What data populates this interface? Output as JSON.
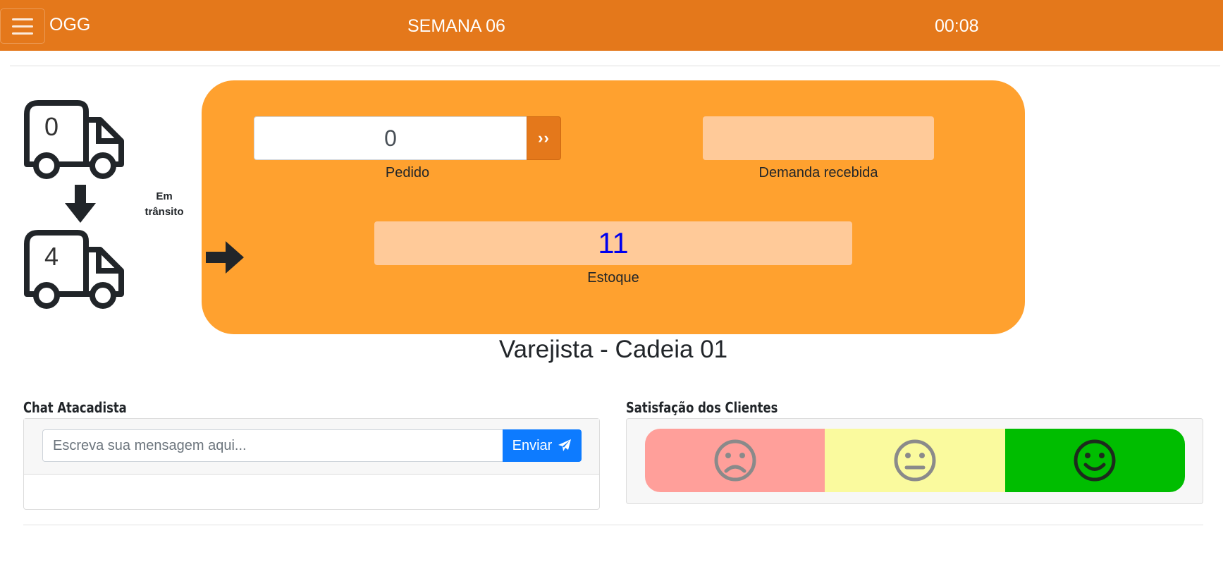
{
  "navbar": {
    "brand": "OGG",
    "week": "SEMANA 06",
    "timer": "00:08",
    "icon": "hamburger-menu-icon",
    "color": "#e4781b"
  },
  "pipeline": {
    "truck_top_count": "0",
    "truck_bottom_count": "4",
    "transit_label_line1": "Em",
    "transit_label_line2": "trânsito",
    "icons": [
      "truck-icon",
      "arrow-down-icon",
      "arrow-right-icon"
    ]
  },
  "station": {
    "order_value": "0",
    "order_button_label": "››",
    "order_label": "Pedido",
    "demand_value": "",
    "demand_label": "Demanda recebida",
    "stock_value": "11",
    "stock_label": "Estoque",
    "title": "Varejista - Cadeia 01",
    "card_color": "#ffa12f",
    "stock_color": "#0000ee"
  },
  "chat": {
    "title": "Chat Atacadista",
    "placeholder": "Escreva sua mensagem aqui...",
    "send_label": "Enviar",
    "send_icon": "paper-plane-icon",
    "button_color": "#0d7bff"
  },
  "satisfaction": {
    "title": "Satisfação dos Clientes",
    "levels": [
      {
        "icon": "sad-face-icon",
        "color": "#ff9f9a",
        "selected": false
      },
      {
        "icon": "neutral-face-icon",
        "color": "#fafa9e",
        "selected": false
      },
      {
        "icon": "happy-face-icon",
        "color": "#00bd00",
        "selected": true
      }
    ]
  }
}
